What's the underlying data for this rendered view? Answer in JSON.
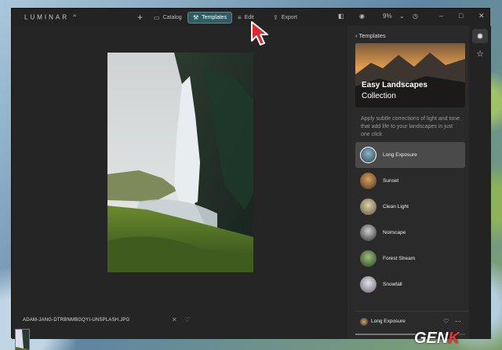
{
  "app": {
    "name": "LUMINAR",
    "version": "AI"
  },
  "toolbar": {
    "catalog_label": "Catalog",
    "templates_label": "Templates",
    "edit_label": "Edit",
    "export_label": "Export",
    "zoom": "9%"
  },
  "canvas": {
    "filename": "ADAM-JANG-DTRBNMBGQYI-UNSPLASH.JPG"
  },
  "panel": {
    "header": "Templates",
    "collection_title": "Easy Landscapes",
    "collection_sub": "Collection",
    "description": "Apply subtle corrections of light and tone that add life to your landscapes in just one click",
    "templates": [
      {
        "label": "Long Exposure",
        "selected": true
      },
      {
        "label": "Sunset",
        "selected": false
      },
      {
        "label": "Clean Light",
        "selected": false
      },
      {
        "label": "Noirscape",
        "selected": false
      },
      {
        "label": "Forest Stream",
        "selected": false
      },
      {
        "label": "Snowfall",
        "selected": false
      }
    ],
    "current_template": "Long Exposure"
  },
  "watermark": {
    "text_a": "GEN",
    "text_b": "K"
  },
  "colors": {
    "accent": "#2d5d63",
    "window_bg": "#232323",
    "panel_bg": "#2a2a2a"
  }
}
